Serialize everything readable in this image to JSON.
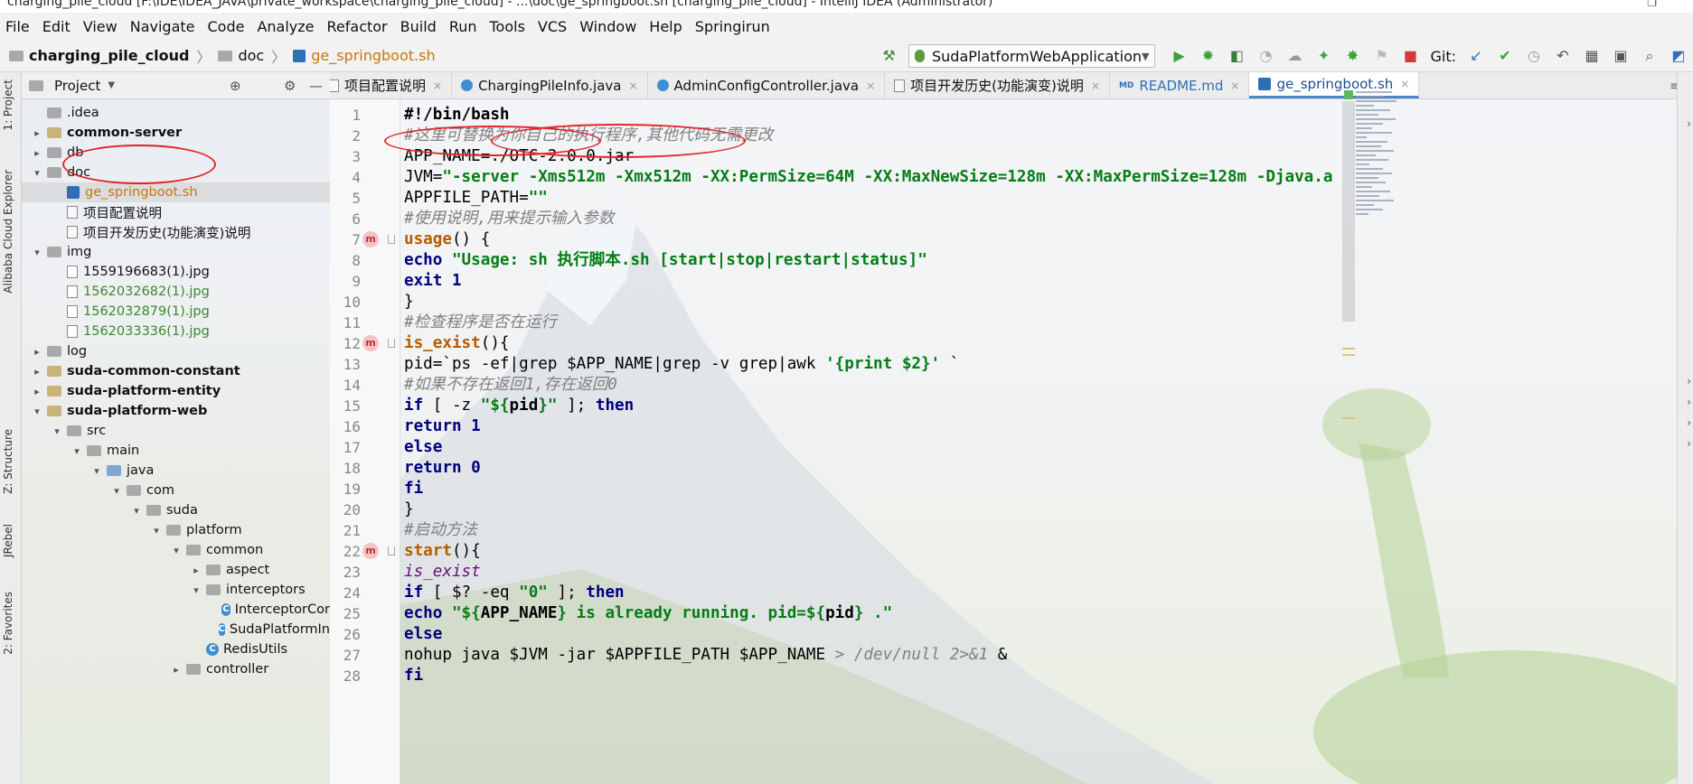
{
  "window": {
    "title": "charging_pile_cloud [F:\\IDE\\IDEA_JAVA\\private_workspace\\charging_pile_cloud] - ...\\doc\\ge_springboot.sh [charging_pile_cloud] - IntelliJ IDEA (Administrator)"
  },
  "menu": [
    "File",
    "Edit",
    "View",
    "Navigate",
    "Code",
    "Analyze",
    "Refactor",
    "Build",
    "Run",
    "Tools",
    "VCS",
    "Window",
    "Help",
    "Springirun"
  ],
  "breadcrumb": {
    "project": "charging_pile_cloud",
    "folder": "doc",
    "file": "ge_springboot.sh"
  },
  "toolbar": {
    "run_config": "SudaPlatformWebApplication",
    "git_label": "Git:"
  },
  "left_tabs": {
    "project": "1: Project",
    "alibaba": "Alibaba Cloud Explorer",
    "structure": "Z: Structure",
    "jrebel": "JRebel",
    "favorites": "2: Favorites"
  },
  "project_pane": {
    "title": "Project"
  },
  "tree": [
    {
      "label": ".idea",
      "depth": 1,
      "arrow": "",
      "icon": "folder-grey",
      "style": ""
    },
    {
      "label": "common-server",
      "depth": 1,
      "arrow": "›",
      "icon": "folder",
      "style": "bold"
    },
    {
      "label": "db",
      "depth": 1,
      "arrow": "›",
      "icon": "folder-grey",
      "style": ""
    },
    {
      "label": "doc",
      "depth": 1,
      "arrow": "⌄",
      "icon": "folder-grey",
      "style": ""
    },
    {
      "label": "ge_springboot.sh",
      "depth": 2,
      "arrow": "",
      "icon": "sh",
      "style": "orange",
      "selected": true
    },
    {
      "label": "项目配置说明",
      "depth": 2,
      "arrow": "",
      "icon": "txt",
      "style": ""
    },
    {
      "label": "项目开发历史(功能演变)说明",
      "depth": 2,
      "arrow": "",
      "icon": "txt",
      "style": ""
    },
    {
      "label": "img",
      "depth": 1,
      "arrow": "⌄",
      "icon": "folder-grey",
      "style": ""
    },
    {
      "label": "1559196683(1).jpg",
      "depth": 2,
      "arrow": "",
      "icon": "jpg",
      "style": ""
    },
    {
      "label": "1562032682(1).jpg",
      "depth": 2,
      "arrow": "",
      "icon": "jpg",
      "style": "green"
    },
    {
      "label": "1562032879(1).jpg",
      "depth": 2,
      "arrow": "",
      "icon": "jpg",
      "style": "green"
    },
    {
      "label": "1562033336(1).jpg",
      "depth": 2,
      "arrow": "",
      "icon": "jpg",
      "style": "green"
    },
    {
      "label": "log",
      "depth": 1,
      "arrow": "›",
      "icon": "folder-grey",
      "style": ""
    },
    {
      "label": "suda-common-constant",
      "depth": 1,
      "arrow": "›",
      "icon": "folder",
      "style": "bold"
    },
    {
      "label": "suda-platform-entity",
      "depth": 1,
      "arrow": "›",
      "icon": "folder",
      "style": "bold"
    },
    {
      "label": "suda-platform-web",
      "depth": 1,
      "arrow": "⌄",
      "icon": "folder",
      "style": "bold"
    },
    {
      "label": "src",
      "depth": 2,
      "arrow": "⌄",
      "icon": "folder-grey",
      "style": ""
    },
    {
      "label": "main",
      "depth": 3,
      "arrow": "⌄",
      "icon": "folder-grey",
      "style": ""
    },
    {
      "label": "java",
      "depth": 4,
      "arrow": "⌄",
      "icon": "folder-blue",
      "style": ""
    },
    {
      "label": "com",
      "depth": 5,
      "arrow": "⌄",
      "icon": "folder-grey",
      "style": ""
    },
    {
      "label": "suda",
      "depth": 6,
      "arrow": "⌄",
      "icon": "folder-grey",
      "style": ""
    },
    {
      "label": "platform",
      "depth": 7,
      "arrow": "⌄",
      "icon": "folder-grey",
      "style": ""
    },
    {
      "label": "common",
      "depth": 8,
      "arrow": "⌄",
      "icon": "folder-grey",
      "style": ""
    },
    {
      "label": "aspect",
      "depth": 9,
      "arrow": "›",
      "icon": "folder-grey",
      "style": ""
    },
    {
      "label": "interceptors",
      "depth": 9,
      "arrow": "⌄",
      "icon": "folder-grey",
      "style": ""
    },
    {
      "label": "InterceptorCor",
      "depth": 10,
      "arrow": "",
      "icon": "class",
      "style": ""
    },
    {
      "label": "SudaPlatformIn",
      "depth": 10,
      "arrow": "",
      "icon": "class",
      "style": ""
    },
    {
      "label": "RedisUtils",
      "depth": 9,
      "arrow": "",
      "icon": "class",
      "style": ""
    },
    {
      "label": "controller",
      "depth": 8,
      "arrow": "›",
      "icon": "folder-grey",
      "style": ""
    }
  ],
  "tabs": [
    {
      "label": "项目配置说明",
      "icon": "txt",
      "active": false
    },
    {
      "label": "ChargingPileInfo.java",
      "icon": "class",
      "active": false
    },
    {
      "label": "AdminConfigController.java",
      "icon": "class",
      "active": false
    },
    {
      "label": "项目开发历史(功能演变)说明",
      "icon": "txt",
      "active": false
    },
    {
      "label": "README.md",
      "icon": "md",
      "active": false
    },
    {
      "label": "ge_springboot.sh",
      "icon": "sh",
      "active": true
    }
  ],
  "tabs_more": "≡5",
  "code_lines": [
    {
      "n": "1",
      "parts": [
        [
          "plb",
          "#!/bin/bash"
        ]
      ]
    },
    {
      "n": "2",
      "parts": [
        [
          "cm",
          "#这里可替换为你自己的执行程序,其他代码无需更改"
        ]
      ]
    },
    {
      "n": "3",
      "parts": [
        [
          "pl",
          "APP_NAME=./OTC-2.0.0.jar"
        ]
      ]
    },
    {
      "n": "4",
      "parts": [
        [
          "pl",
          "JVM="
        ],
        [
          "st",
          "\"-server -Xms512m -Xmx512m -XX:PermSize=64M -XX:MaxNewSize=128m -XX:MaxPermSize=128m -Djava.a"
        ]
      ]
    },
    {
      "n": "5",
      "parts": [
        [
          "pl",
          "APPFILE_PATH="
        ],
        [
          "st",
          "\"\""
        ]
      ]
    },
    {
      "n": "6",
      "parts": [
        [
          "cm",
          "#使用说明,用来提示输入参数"
        ]
      ]
    },
    {
      "n": "7",
      "mark": "m",
      "parts": [
        [
          "fn",
          "usage"
        ],
        [
          "pl",
          "() {"
        ]
      ]
    },
    {
      "n": "8",
      "parts": [
        [
          "kw",
          "echo "
        ],
        [
          "st",
          "\"Usage: sh 执行脚本.sh [start|stop|restart|status]\""
        ]
      ]
    },
    {
      "n": "9",
      "parts": [
        [
          "kw",
          "exit "
        ],
        [
          "kw",
          "1"
        ]
      ]
    },
    {
      "n": "10",
      "parts": [
        [
          "pl",
          "}"
        ]
      ]
    },
    {
      "n": "11",
      "parts": [
        [
          "cm",
          "#检查程序是否在运行"
        ]
      ]
    },
    {
      "n": "12",
      "mark": "m",
      "parts": [
        [
          "fn",
          "is_exist"
        ],
        [
          "pl",
          "(){"
        ]
      ]
    },
    {
      "n": "13",
      "parts": [
        [
          "pl",
          "pid=`ps -ef|grep $APP_NAME|grep -v grep|awk "
        ],
        [
          "st",
          "'{print $2}'"
        ],
        [
          "pl",
          " `"
        ]
      ]
    },
    {
      "n": "14",
      "parts": [
        [
          "cm",
          "#如果不存在返回1,存在返回0"
        ]
      ]
    },
    {
      "n": "15",
      "parts": [
        [
          "kw",
          "if "
        ],
        [
          "pl",
          "[ -z "
        ],
        [
          "st",
          "\"${"
        ],
        [
          "plb",
          "pid"
        ],
        [
          "st",
          "}\""
        ],
        [
          "pl",
          " ]; "
        ],
        [
          "kw",
          "then"
        ]
      ]
    },
    {
      "n": "16",
      "parts": [
        [
          "kw",
          "return "
        ],
        [
          "kw",
          "1"
        ]
      ]
    },
    {
      "n": "17",
      "parts": [
        [
          "kw",
          "else"
        ]
      ]
    },
    {
      "n": "18",
      "parts": [
        [
          "kw",
          "return "
        ],
        [
          "kw",
          "0"
        ]
      ]
    },
    {
      "n": "19",
      "parts": [
        [
          "kw",
          "fi"
        ]
      ]
    },
    {
      "n": "20",
      "parts": [
        [
          "pl",
          "}"
        ]
      ]
    },
    {
      "n": "21",
      "parts": [
        [
          "cm",
          "#启动方法"
        ]
      ]
    },
    {
      "n": "22",
      "mark": "m",
      "parts": [
        [
          "fn",
          "start"
        ],
        [
          "pl",
          "(){"
        ]
      ]
    },
    {
      "n": "23",
      "parts": [
        [
          "va",
          "is_exist"
        ]
      ]
    },
    {
      "n": "24",
      "parts": [
        [
          "kw",
          "if "
        ],
        [
          "pl",
          "[ $? -eq "
        ],
        [
          "st",
          "\"0\""
        ],
        [
          "pl",
          " ]; "
        ],
        [
          "kw",
          "then"
        ]
      ]
    },
    {
      "n": "25",
      "parts": [
        [
          "kw",
          "echo "
        ],
        [
          "st",
          "\"${"
        ],
        [
          "plb",
          "APP_NAME"
        ],
        [
          "st",
          "} is already running. pid=${"
        ],
        [
          "plb",
          "pid"
        ],
        [
          "st",
          "} .\""
        ]
      ]
    },
    {
      "n": "26",
      "parts": [
        [
          "kw",
          "else"
        ]
      ]
    },
    {
      "n": "27",
      "parts": [
        [
          "pl",
          "nohup java $JVM -jar $APPFILE_PATH $APP_NAME "
        ],
        [
          "cm",
          "> /dev/null 2>&1"
        ],
        [
          "pl",
          " &"
        ]
      ]
    },
    {
      "n": "28",
      "parts": [
        [
          "kw",
          "fi"
        ]
      ]
    }
  ]
}
